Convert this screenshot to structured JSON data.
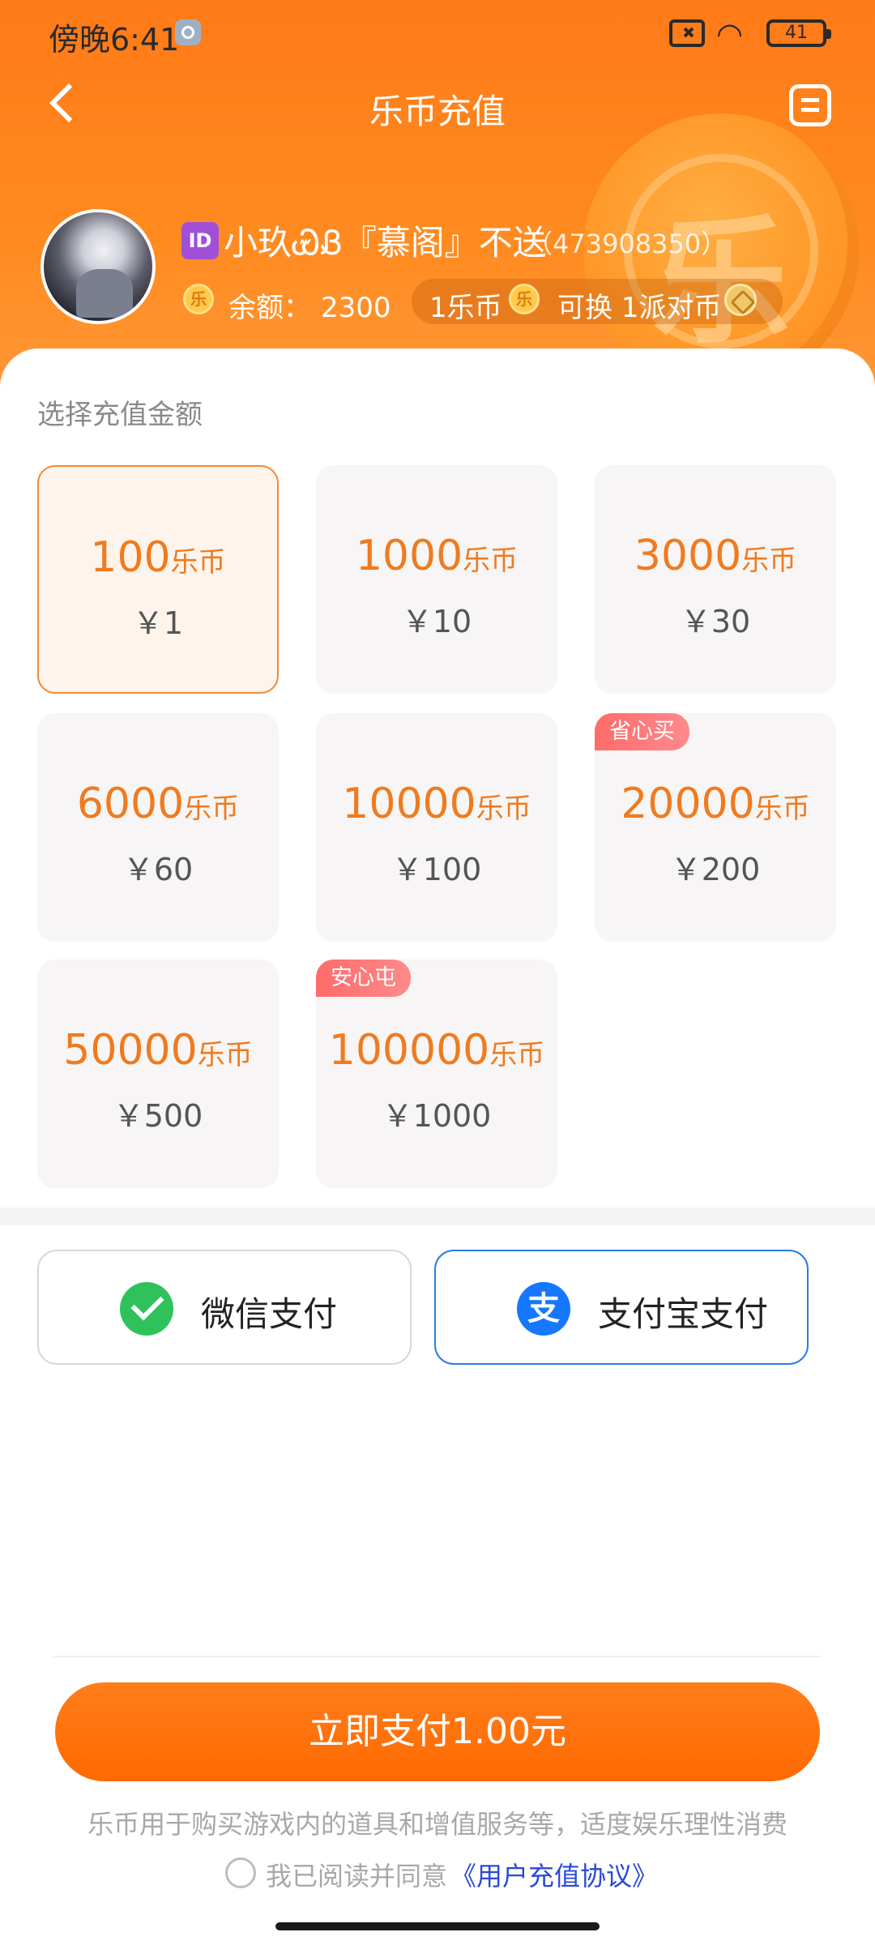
{
  "status_bar": {
    "time": "傍晚6:41",
    "battery": "41"
  },
  "nav": {
    "title": "乐币充值"
  },
  "profile": {
    "id_badge": "ID",
    "nickname": "小玖ᏯᏰ『慕阁』不送",
    "uid": "（473908350）",
    "balance_label": "余额：",
    "balance_value": "2300",
    "coin_glyph": "乐",
    "exchange_a": "1乐币",
    "exchange_b": "可换 1派对币"
  },
  "section_title": "选择充值金额",
  "packages": [
    {
      "coins": "100",
      "unit": "乐币",
      "price": "￥1",
      "tag": ""
    },
    {
      "coins": "1000",
      "unit": "乐币",
      "price": "￥10",
      "tag": ""
    },
    {
      "coins": "3000",
      "unit": "乐币",
      "price": "￥30",
      "tag": ""
    },
    {
      "coins": "6000",
      "unit": "乐币",
      "price": "￥60",
      "tag": ""
    },
    {
      "coins": "10000",
      "unit": "乐币",
      "price": "￥100",
      "tag": ""
    },
    {
      "coins": "20000",
      "unit": "乐币",
      "price": "￥200",
      "tag": "省心买"
    },
    {
      "coins": "50000",
      "unit": "乐币",
      "price": "￥500",
      "tag": ""
    },
    {
      "coins": "100000",
      "unit": "乐币",
      "price": "￥1000",
      "tag": "安心屯"
    }
  ],
  "payment": {
    "wechat_label": "微信支付",
    "alipay_label": "支付宝支付",
    "alipay_glyph": "支"
  },
  "submit_label": "立即支付1.00元",
  "notice": "乐币用于购买游戏内的道具和增值服务等，适度娱乐理性消费",
  "agreement": {
    "text": "我已阅读并同意",
    "link": "《用户充值协议》"
  },
  "colors": {
    "accent": "#ff6a00",
    "price_text": "#ef7b1f",
    "link": "#2a49d8",
    "tag": "#ff6b6b"
  }
}
